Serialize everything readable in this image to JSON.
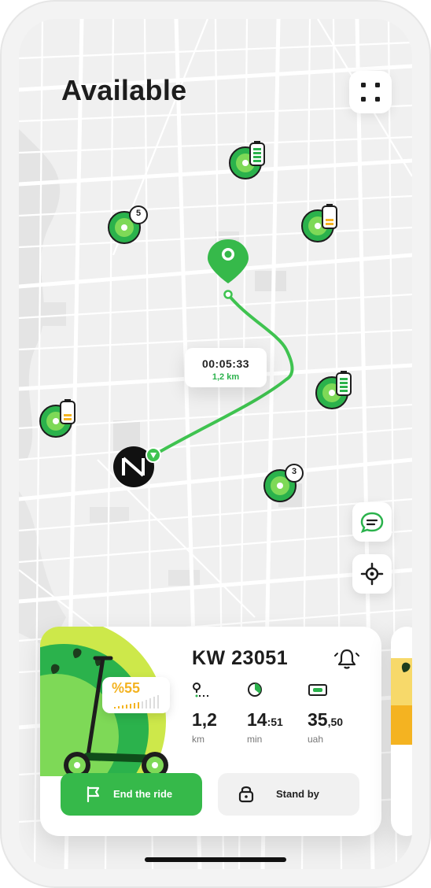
{
  "header": {
    "title": "Available"
  },
  "map": {
    "clusters": [
      {
        "count": "5"
      },
      {
        "count": "3"
      }
    ],
    "route": {
      "time": "00:05:33",
      "distance": "1,2 km"
    }
  },
  "scooter_card": {
    "name": "KW 23051",
    "battery_label": "%55",
    "stats": [
      {
        "main": "1,2",
        "frac": "",
        "unit": "km",
        "icon": "route-icon"
      },
      {
        "main": "14",
        "frac": ":51",
        "unit": "min",
        "icon": "timer-icon"
      },
      {
        "main": "35",
        "frac": ",50",
        "unit": "uah",
        "icon": "cash-icon"
      }
    ],
    "end_ride_label": "End the ride",
    "stand_by_label": "Stand by"
  },
  "colors": {
    "accent_green": "#36b94a",
    "kiwi_green": "#2bb24c",
    "battery_yellow": "#f4b321",
    "text_dark": "#1d1d1d"
  }
}
